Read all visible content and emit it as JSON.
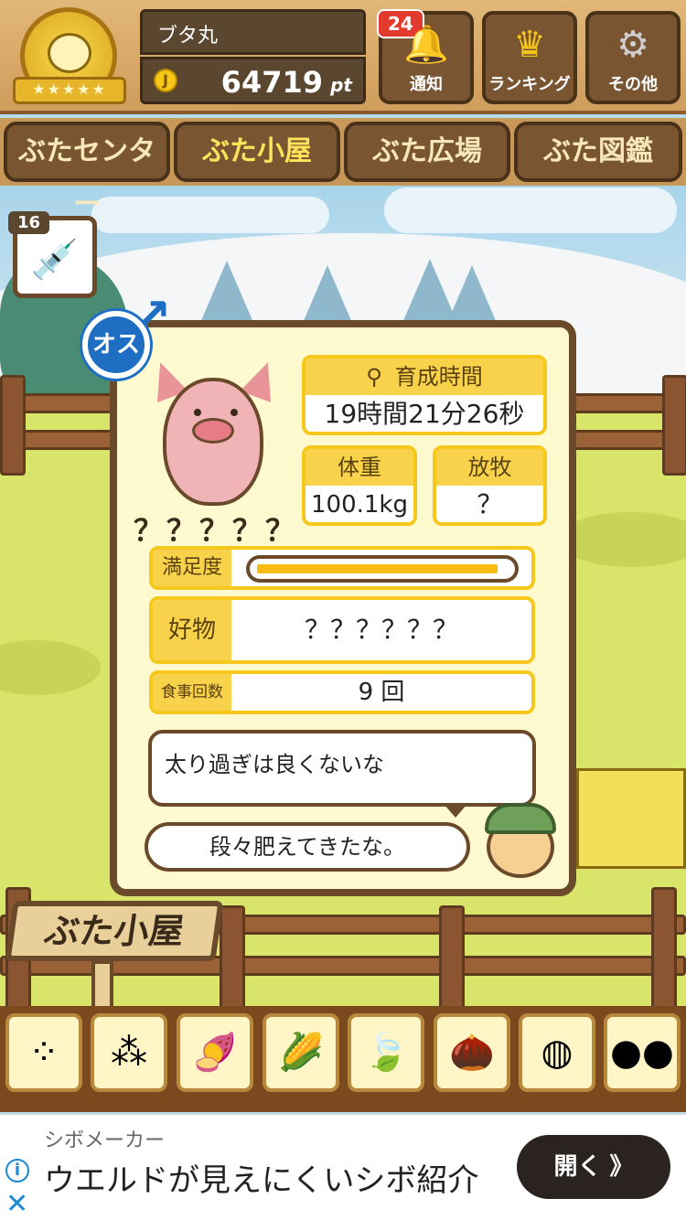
{
  "header": {
    "player_name": "ブタ丸",
    "coin_symbol": "J",
    "points": "64719",
    "points_unit": "pt",
    "medal_stars": "★★★★★",
    "buttons": [
      {
        "label": "通知",
        "icon": "bell-icon",
        "badge": "24"
      },
      {
        "label": "ランキング",
        "icon": "crown-icon"
      },
      {
        "label": "その他",
        "icon": "gear-icon"
      }
    ]
  },
  "tabs": [
    {
      "label": "ぶたセンター",
      "active": false
    },
    {
      "label": "ぶた小屋",
      "active": true
    },
    {
      "label": "ぶた広場",
      "active": false
    },
    {
      "label": "ぶた図鑑",
      "active": false
    }
  ],
  "item": {
    "count": "16",
    "icon": "syringe-icon"
  },
  "pig": {
    "gender": "オス",
    "name": "？？？？？",
    "raising_time_label": "育成時間",
    "raising_time": "19時間21分26秒",
    "weight_label": "体重",
    "weight": "100.1kg",
    "grazing_label": "放牧",
    "grazing": "？",
    "satisfaction_label": "満足度",
    "satisfaction_fraction": 0.96,
    "favorite_label": "好物",
    "favorite": "？？？？？？",
    "meals_label": "食事回数",
    "meals": "9 回",
    "pig_speech": "太り過ぎは良くないな",
    "farmer_speech": "段々肥えてきたな。"
  },
  "sign": "ぶた小屋",
  "foods": [
    {
      "icon": "soybeans-icon"
    },
    {
      "icon": "mixed-beans-icon"
    },
    {
      "icon": "sweet-potato-icon"
    },
    {
      "icon": "corn-icon"
    },
    {
      "icon": "ginkgo-icon"
    },
    {
      "icon": "acorn-icon"
    },
    {
      "icon": "grain-plate-icon"
    },
    {
      "icon": "dango-plate-icon"
    }
  ],
  "ad": {
    "advertiser": "シボメーカー",
    "title": "ウエルドが見えにくいシボ紹介",
    "button": "開く 》"
  },
  "colors": {
    "accent_yellow": "#f8d24a",
    "wood": "#7a5532",
    "male_blue": "#1e6fc4"
  }
}
